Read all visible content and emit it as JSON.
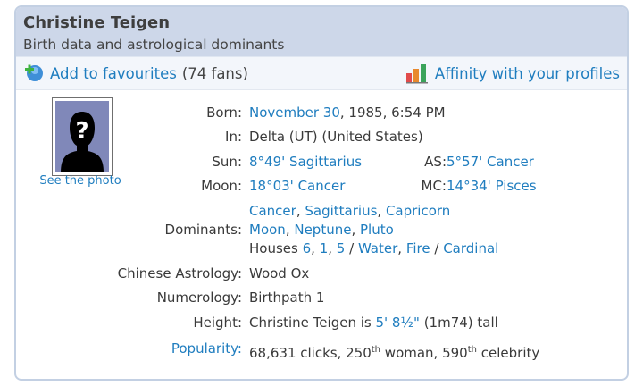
{
  "header": {
    "title": "Christine Teigen",
    "subtitle": "Birth data and astrological dominants"
  },
  "actions": {
    "favourites_label": "Add to favourites",
    "fans_text": "(74 fans)",
    "affinity_label": "Affinity with your profiles"
  },
  "photo": {
    "see_photo_label": "See the photo"
  },
  "details": {
    "born_label": "Born:",
    "born_month_day": "November 30",
    "born_rest": ", 1985, 6:54 PM",
    "in_label": "In:",
    "in_value": "Delta (UT) (United States)",
    "sun_label": "Sun:",
    "sun_value": "8°49' Sagittarius",
    "as_label": "AS:",
    "as_value": "5°57' Cancer",
    "moon_label": "Moon:",
    "moon_value": "18°03' Cancer",
    "mc_label": "MC:",
    "mc_value": "14°34' Pisces",
    "dominants_label": "Dominants:",
    "dominant_signs": [
      "Cancer",
      "Sagittarius",
      "Capricorn"
    ],
    "dominant_planets": [
      "Moon",
      "Neptune",
      "Pluto"
    ],
    "houses_prefix": "Houses",
    "dominant_houses": [
      "6",
      "1",
      "5"
    ],
    "dominant_elements": [
      "Water",
      "Fire"
    ],
    "dominant_mode": "Cardinal",
    "chinese_label": "Chinese Astrology:",
    "chinese_value": "Wood Ox",
    "numerology_label": "Numerology:",
    "numerology_value": "Birthpath 1",
    "height_label": "Height:",
    "height_prefix": "Christine Teigen is",
    "height_value": "5' 8½\"",
    "height_suffix": "(1m74) tall",
    "popularity_label": "Popularity:",
    "popularity_clicks": "68,631 clicks, 250",
    "popularity_th1": "th",
    "popularity_mid": " woman, 590",
    "popularity_th2": "th",
    "popularity_end": " celebrity"
  },
  "colors": {
    "link": "#1f7dbf",
    "header_bg": "#cdd7e9",
    "border": "#c3d0e3"
  }
}
